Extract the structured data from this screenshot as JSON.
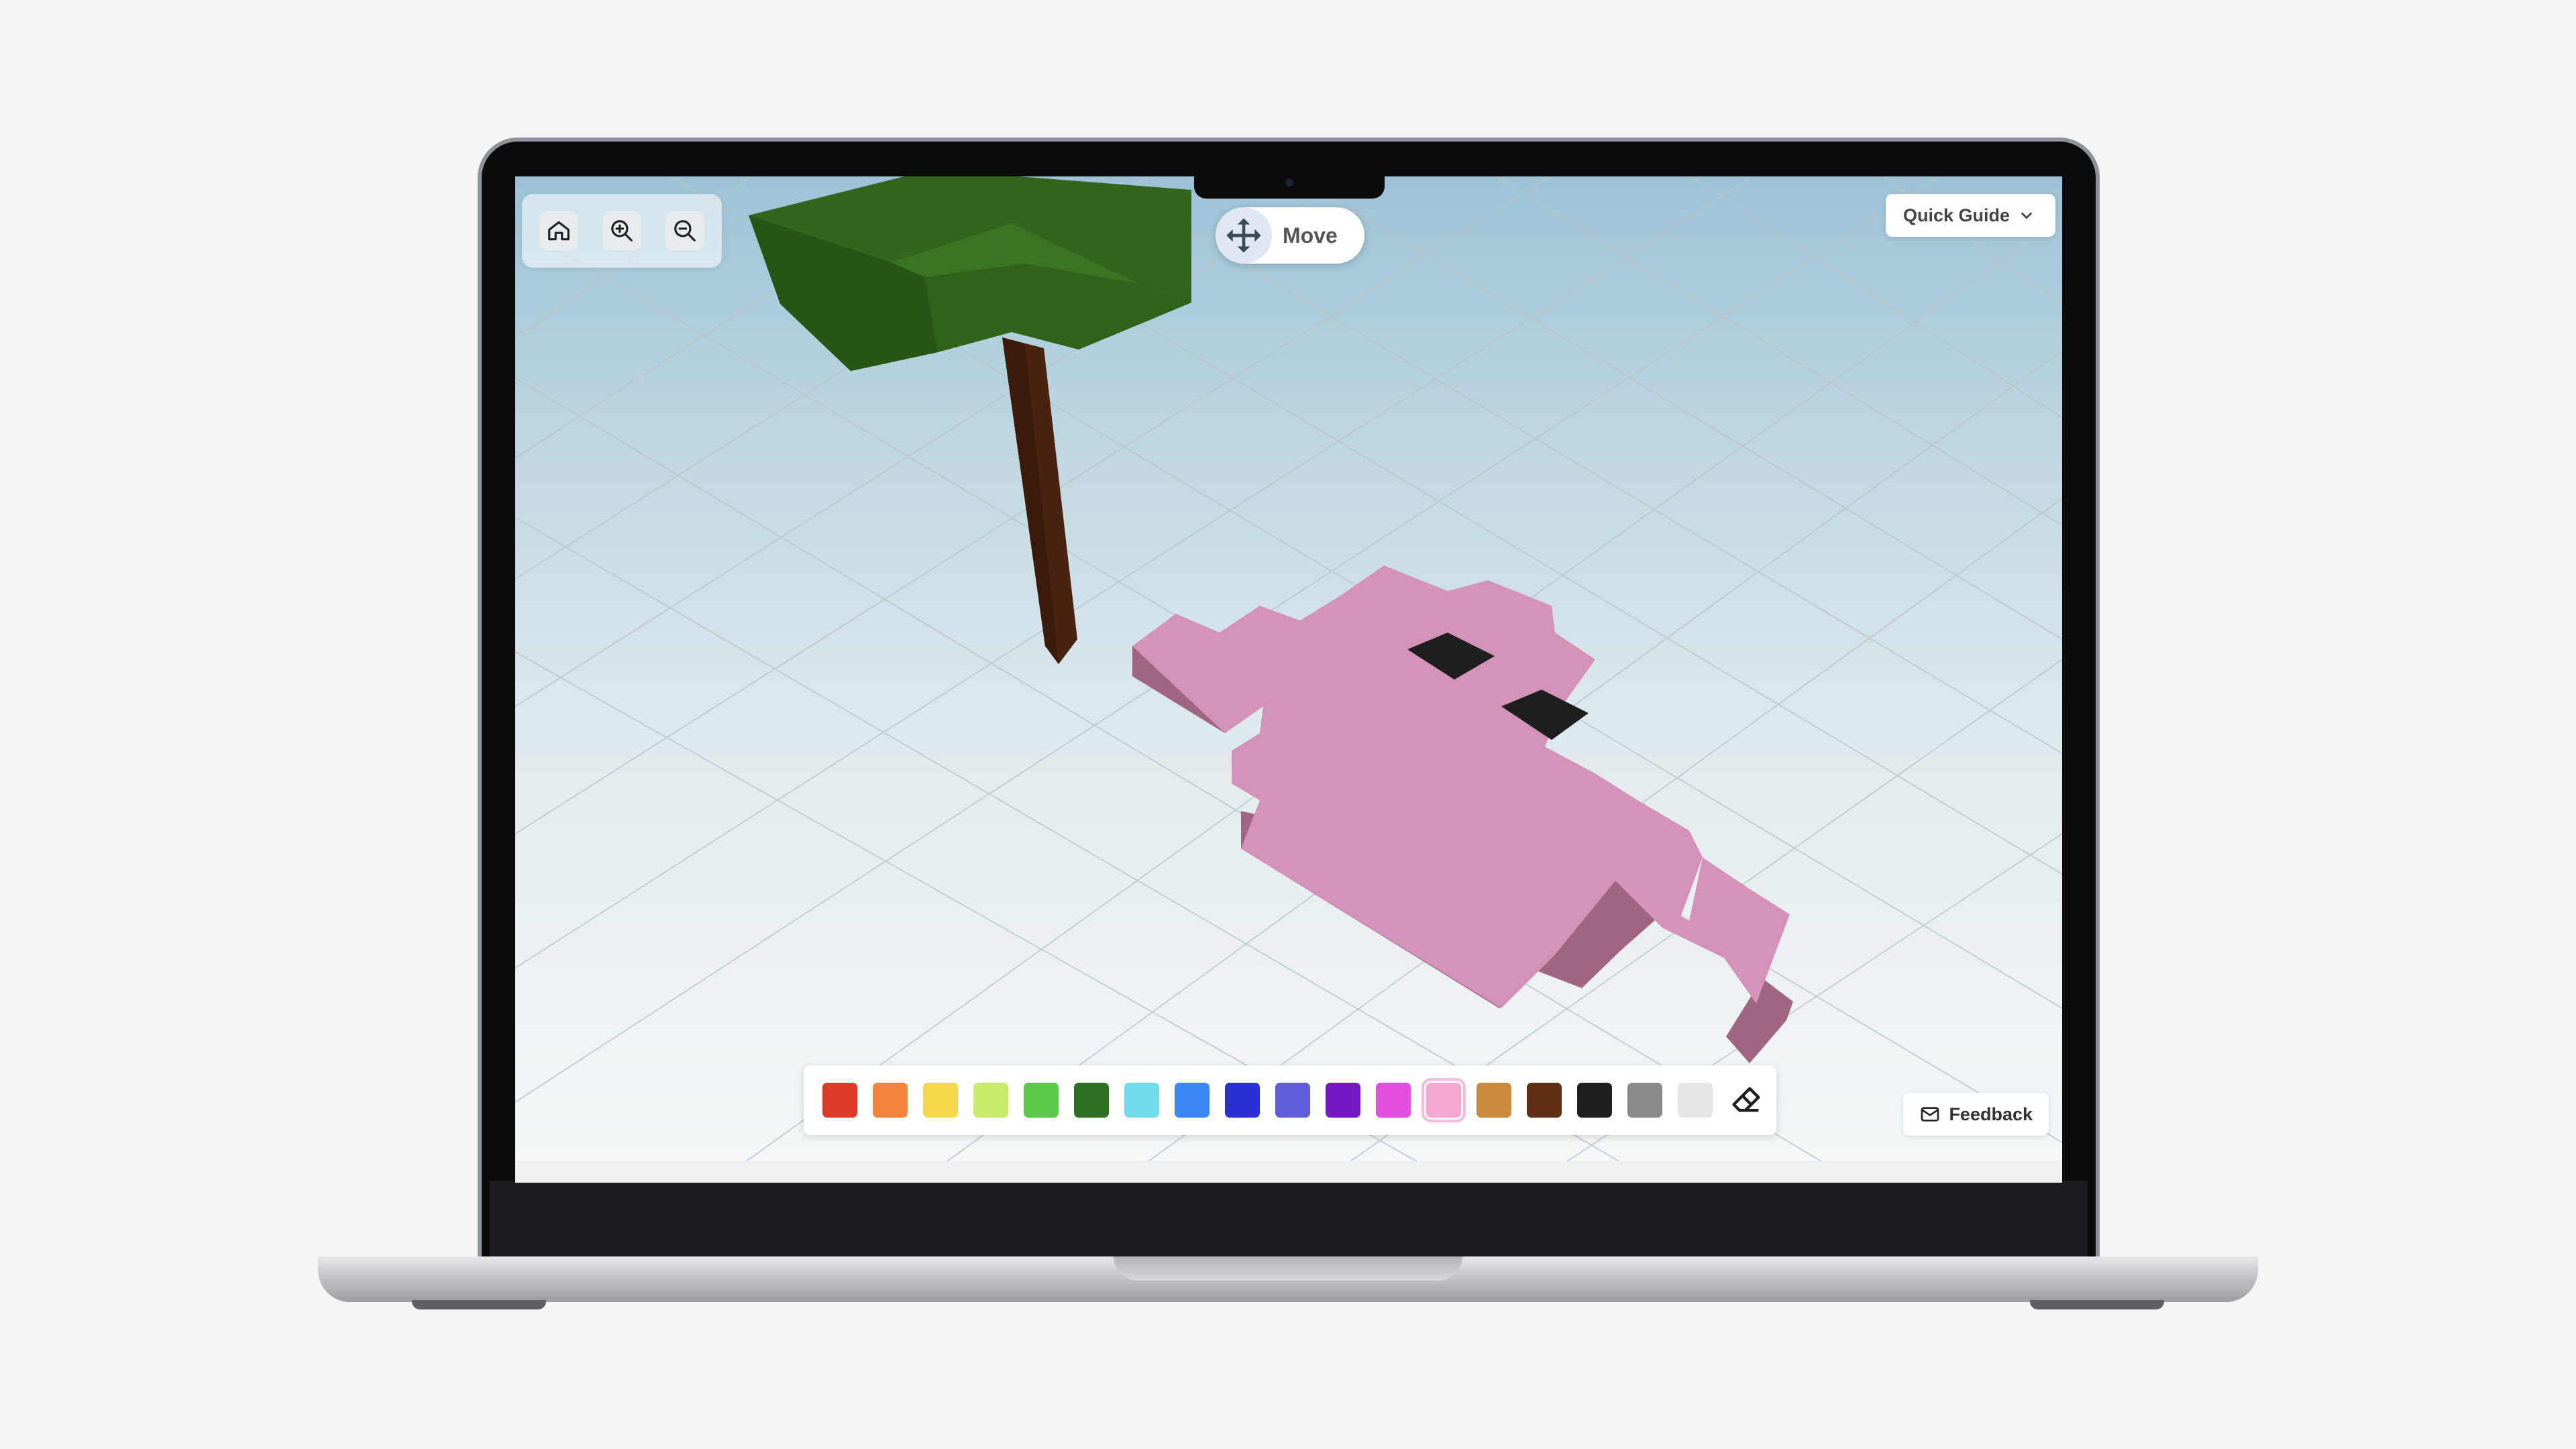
{
  "toolbar": {
    "home_icon": "home-icon",
    "zoom_in_icon": "zoom-in-icon",
    "zoom_out_icon": "zoom-out-icon"
  },
  "mode": {
    "label": "Move",
    "icon": "move-arrows-icon"
  },
  "guide": {
    "label": "Quick Guide",
    "icon": "chevron-down-icon"
  },
  "palette": {
    "colors": [
      "#dd3a28",
      "#f0843a",
      "#f6d84a",
      "#c9ea6b",
      "#5cc84a",
      "#2f6f22",
      "#72dcea",
      "#3a86f2",
      "#2a2fd6",
      "#5e5ed6",
      "#7418c2",
      "#e24fe0",
      "#f6a6cf",
      "#cc8a3e",
      "#5f2f14",
      "#1e1e1e",
      "#8a8a8a",
      "#e4e4e4"
    ],
    "selected_index": 12,
    "eraser_icon": "eraser-icon"
  },
  "feedback": {
    "label": "Feedback",
    "icon": "mail-icon"
  },
  "scene_colors": {
    "grid_line": "#b9c3c8",
    "creature_top": "#d592b8",
    "creature_side": "#a06582",
    "eyes": "#1e1e1e",
    "leaves_top": "#31661c",
    "leaves_side": "#2a5a17",
    "trunk": "#4a2310"
  }
}
